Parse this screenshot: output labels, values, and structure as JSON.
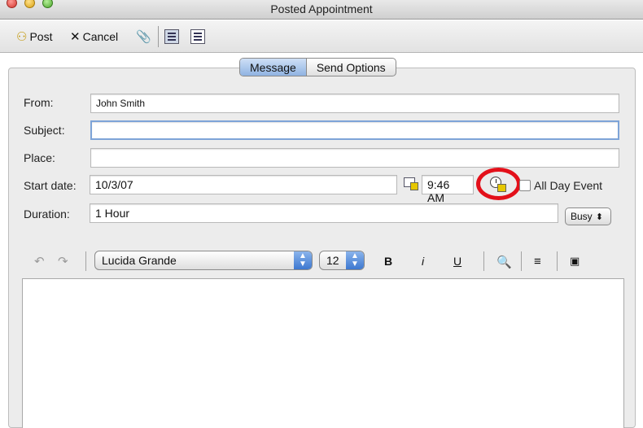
{
  "window": {
    "title": "Posted Appointment"
  },
  "toolbar": {
    "post_label": "Post",
    "cancel_label": "Cancel",
    "icons": [
      "post-icon",
      "cancel-icon",
      "attach-icon",
      "view-icon",
      "view-alt-icon"
    ]
  },
  "tabs": [
    {
      "label": "Message",
      "active": true
    },
    {
      "label": "Send Options",
      "active": false
    }
  ],
  "form": {
    "from": {
      "label": "From:",
      "value": "John Smith"
    },
    "subject": {
      "label": "Subject:",
      "value": ""
    },
    "place": {
      "label": "Place:",
      "value": ""
    },
    "start": {
      "label": "Start date:",
      "date": "10/3/07",
      "time": "9:46 AM",
      "all_day_label": "All Day Event",
      "all_day_checked": false
    },
    "duration": {
      "label": "Duration:",
      "value": "1 Hour",
      "show_as": "Busy"
    }
  },
  "format": {
    "font": "Lucida Grande",
    "size": "12",
    "bold": "B",
    "italic": "i",
    "underline": "U"
  },
  "colors": {
    "highlight_ring": "#e3101a",
    "accent": "#7ea4d8"
  }
}
